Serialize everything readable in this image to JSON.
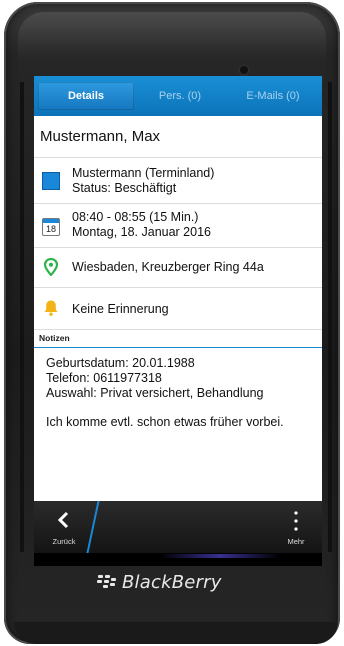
{
  "tabs": [
    {
      "label": "Details",
      "active": true
    },
    {
      "label": "Pers. (0)",
      "active": false
    },
    {
      "label": "E-Mails (0)",
      "active": false
    }
  ],
  "contact": {
    "name": "Mustermann, Max"
  },
  "rows": {
    "organization": {
      "line1": "Mustermann (Terminland)",
      "line2": "Status: Beschäftigt",
      "icon": "blue-square-icon"
    },
    "time": {
      "line1": "08:40 - 08:55 (15 Min.)",
      "line2": "Montag, 18. Januar 2016",
      "icon": "calendar-icon",
      "icon_day": "18"
    },
    "location": {
      "text": "Wiesbaden, Kreuzberger Ring 44a",
      "icon": "map-pin-icon"
    },
    "reminder": {
      "text": "Keine Erinnerung",
      "icon": "bell-icon"
    }
  },
  "notes": {
    "header": "Notizen",
    "lines": [
      "Geburtsdatum: 20.01.1988",
      "Telefon: 0611977318",
      "Auswahl: Privat versichert, Behandlung",
      "Ich komme evtl. schon etwas früher vorbei."
    ]
  },
  "actionbar": {
    "back_label": "Zurück",
    "more_label": "Mehr"
  },
  "brand": {
    "name": "BlackBerry"
  },
  "colors": {
    "accent": "#1a88d8",
    "tabbar": "#0c73b9",
    "location_pin": "#2db34a",
    "bell": "#f3b418"
  }
}
